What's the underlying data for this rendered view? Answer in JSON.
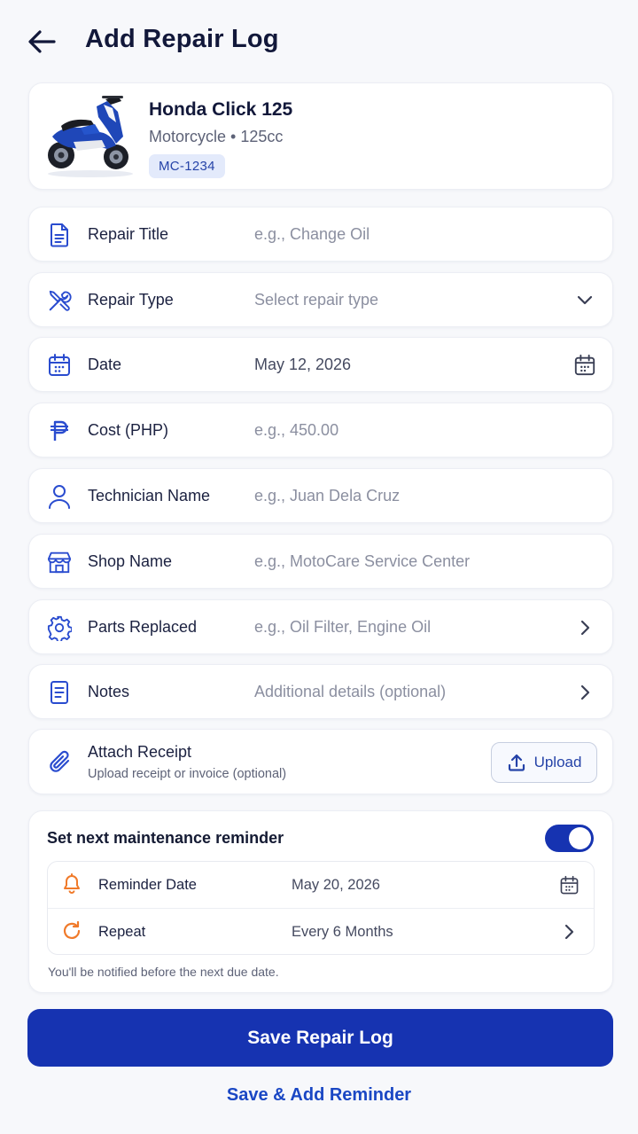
{
  "header": {
    "title": "Add Repair Log"
  },
  "vehicle": {
    "name": "Honda Click 125",
    "subtitle": "Motorcycle • 125cc",
    "plate": "MC-1234"
  },
  "form": {
    "repair_title": {
      "label": "Repair Title",
      "placeholder": "e.g., Change Oil",
      "icon": "document-icon"
    },
    "repair_type": {
      "label": "Repair Type",
      "placeholder": "Select repair type",
      "icon": "tools-icon"
    },
    "date": {
      "label": "Date",
      "value": "May 12, 2026",
      "icon": "calendar-icon"
    },
    "cost": {
      "label": "Cost (PHP)",
      "placeholder": "e.g., 450.00",
      "icon": "peso-icon"
    },
    "technician": {
      "label": "Technician Name",
      "placeholder": "e.g., Juan Dela Cruz",
      "icon": "user-icon"
    },
    "shop": {
      "label": "Shop Name",
      "placeholder": "e.g., MotoCare Service Center",
      "icon": "store-icon"
    },
    "parts": {
      "label": "Parts Replaced",
      "placeholder": "e.g., Oil Filter, Engine Oil",
      "icon": "gear-icon"
    },
    "notes": {
      "label": "Notes",
      "placeholder": "Additional details (optional)",
      "icon": "notes-icon"
    }
  },
  "receipt": {
    "title": "Attach Receipt",
    "subtitle": "Upload receipt or invoice (optional)",
    "button_label": "Upload"
  },
  "reminder": {
    "title": "Set next maintenance reminder",
    "enabled": true,
    "date_label": "Reminder Date",
    "date_value": "May 20, 2026",
    "repeat_label": "Repeat",
    "repeat_value": "Every 6 Months",
    "hint": "You'll be notified before the next due date."
  },
  "actions": {
    "save_label": "Save Repair Log",
    "save_reminder_label": "Save & Add Reminder"
  },
  "colors": {
    "primary": "#1633b1",
    "accent_blue": "#1a47c4",
    "icon_blue": "#2a4ccf",
    "reminder_orange": "#f07a2a"
  }
}
